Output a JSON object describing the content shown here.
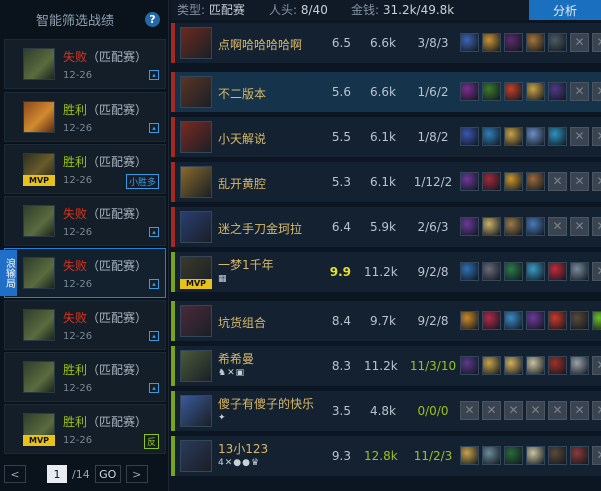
{
  "sidebar": {
    "title": "智能筛选战绩",
    "help_icon": "?",
    "ribbon": "浪输局",
    "matches": [
      {
        "result": "失败",
        "result_type": "lose",
        "mode": "（匹配赛）",
        "date": "12-26",
        "mvp": "",
        "tag": "",
        "avatar": "a1"
      },
      {
        "result": "胜利",
        "result_type": "win",
        "mode": "（匹配赛）",
        "date": "12-26",
        "mvp": "",
        "tag": "",
        "avatar": "a2"
      },
      {
        "result": "胜利",
        "result_type": "win",
        "mode": "（匹配赛）",
        "date": "12-26",
        "mvp": "MVP",
        "tag": "小胜多",
        "avatar": "a3"
      },
      {
        "result": "失败",
        "result_type": "lose",
        "mode": "（匹配赛）",
        "date": "12-26",
        "mvp": "",
        "tag": "",
        "avatar": "a1"
      },
      {
        "result": "失败",
        "result_type": "lose",
        "mode": "（匹配赛）",
        "date": "12-26",
        "mvp": "",
        "tag": "",
        "avatar": "a1"
      },
      {
        "result": "失败",
        "result_type": "lose",
        "mode": "（匹配赛）",
        "date": "12-26",
        "mvp": "",
        "tag": "",
        "avatar": "a1"
      },
      {
        "result": "胜利",
        "result_type": "win",
        "mode": "（匹配赛）",
        "date": "12-26",
        "mvp": "",
        "tag": "",
        "avatar": "a1"
      },
      {
        "result": "胜利",
        "result_type": "win",
        "mode": "（匹配赛）",
        "date": "12-26",
        "mvp": "MVP",
        "tag": "反",
        "avatar": "a1"
      }
    ],
    "pager": {
      "prev": "<",
      "page": "1",
      "total": "/14",
      "go": "GO",
      "next": ">"
    }
  },
  "topbar": {
    "type_label": "类型:",
    "type_value": "匹配赛",
    "kills_label": "人头:",
    "kills_value": "8/40",
    "gold_label": "金钱:",
    "gold_value": "31.2k/49.8k",
    "analyze": "分析"
  },
  "colors": {
    "lose": "#d6341f",
    "win": "#9ac21c",
    "accent": "#1b6fbf",
    "stripe_lose": "#a32a22",
    "stripe_win": "#7aa31c"
  },
  "players": [
    {
      "name": "点啊哈哈哈哈啊",
      "score": "6.5",
      "gold": "6.6k",
      "kda": "3/8/3",
      "team": "lose",
      "me": false,
      "mvp": "",
      "honors": "",
      "avatar_color": "#6b2a1e",
      "items": [
        "#3f63b4",
        "#c99237",
        "#5a2c6a",
        "#a3753b",
        "#4d5a64",
        "empty",
        "empty"
      ]
    },
    {
      "name": "不二版本",
      "score": "5.6",
      "gold": "6.6k",
      "kda": "1/6/2",
      "team": "lose",
      "me": true,
      "mvp": "",
      "honors": "",
      "avatar_color": "#5a3525",
      "items": [
        "#7a2f8f",
        "#3b7a2d",
        "#c2402a",
        "#c9a246",
        "#4f3a86",
        "empty",
        "empty"
      ]
    },
    {
      "name": "小天解说",
      "score": "5.5",
      "gold": "6.1k",
      "kda": "1/8/2",
      "team": "lose",
      "me": false,
      "mvp": "",
      "honors": "",
      "avatar_color": "#7a2a22",
      "items": [
        "#3b56b0",
        "#2f7fb8",
        "#c9a246",
        "#6a8fc4",
        "#2d93c0",
        "empty",
        "empty"
      ]
    },
    {
      "name": "乱开黄腔",
      "score": "5.3",
      "gold": "6.1k",
      "kda": "1/12/2",
      "team": "lose",
      "me": false,
      "mvp": "",
      "honors": "",
      "avatar_color": "#8a6a2a",
      "items": [
        "#6a3a9a",
        "#a02a3a",
        "#c9952f",
        "#9a6a3a",
        "empty",
        "empty",
        "empty"
      ]
    },
    {
      "name": "迷之手刀金珂拉",
      "score": "6.4",
      "gold": "5.9k",
      "kda": "2/6/3",
      "team": "lose",
      "me": false,
      "mvp": "",
      "honors": "",
      "avatar_color": "#2a3e72",
      "items": [
        "#6a3a9a",
        "#c9b06a",
        "#9a7a4a",
        "#4a7ab8",
        "empty",
        "empty",
        "empty"
      ]
    },
    {
      "name": "一梦1千年",
      "score": "9.9",
      "gold": "11.2k",
      "kda": "9/2/8",
      "team": "win",
      "me": false,
      "mvp": "MVP",
      "honors": "▦",
      "avatar_color": "#3a3a2a",
      "items": [
        "#2e6fb5",
        "#6a6a7a",
        "#2a7a4a",
        "#3a9ac4",
        "#c02a3a",
        "#7a8a9a",
        "empty"
      ]
    },
    {
      "name": "坑货组合",
      "score": "8.4",
      "gold": "9.7k",
      "kda": "9/2/8",
      "team": "win",
      "me": false,
      "mvp": "",
      "honors": "",
      "avatar_color": "#4a2a3a",
      "items": [
        "#c98a2a",
        "#b02a4a",
        "#3a8ac4",
        "#6a3a9a",
        "#c83a2a",
        "#5a4a3a",
        "#6ac02a"
      ]
    },
    {
      "name": "希希曼",
      "score": "8.3",
      "gold": "11.2k",
      "kda": "11/3/10",
      "team": "win",
      "me": false,
      "mvp": "",
      "honors": "♞✕▣",
      "avatar_color": "#4a5a3a",
      "items": [
        "#5a3a8a",
        "#c9a24a",
        "#d0b060",
        "#c9c2a0",
        "#a0302a",
        "#9aa2aa",
        "empty"
      ]
    },
    {
      "name": "傻子有傻子的快乐",
      "score": "3.5",
      "gold": "4.8k",
      "kda": "0/0/0",
      "team": "win",
      "me": false,
      "mvp": "",
      "honors": "✦",
      "avatar_color": "#3a5a9a",
      "items": [
        "empty",
        "empty",
        "empty",
        "empty",
        "empty",
        "empty",
        "empty"
      ]
    },
    {
      "name": "13小123",
      "score": "9.3",
      "gold": "12.8k",
      "kda": "11/2/3",
      "team": "win",
      "me": false,
      "mvp": "",
      "honors": "4✕●●♛",
      "avatar_color": "#2a3a5a",
      "items": [
        "#c9a24a",
        "#6a8a9a",
        "#2a6a3a",
        "#c9c2a0",
        "#5a4a3a",
        "#8a3a3a",
        "empty"
      ]
    }
  ]
}
